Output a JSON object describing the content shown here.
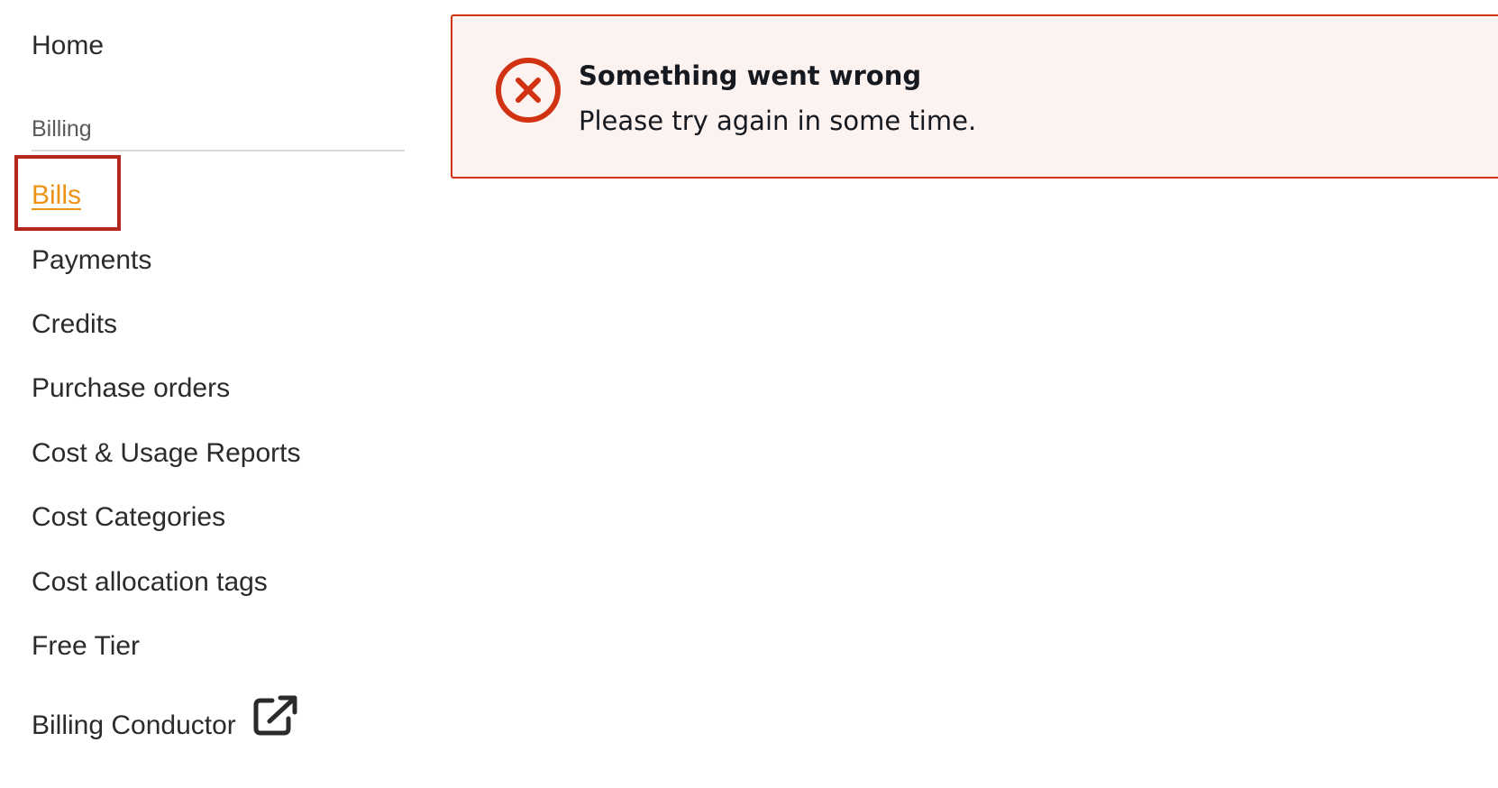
{
  "sidebar": {
    "home_label": "Home",
    "section_title": "Billing",
    "items": [
      {
        "label": "Bills",
        "active": true
      },
      {
        "label": "Payments"
      },
      {
        "label": "Credits"
      },
      {
        "label": "Purchase orders"
      },
      {
        "label": "Cost & Usage Reports"
      },
      {
        "label": "Cost Categories"
      },
      {
        "label": "Cost allocation tags"
      },
      {
        "label": "Free Tier"
      },
      {
        "label": "Billing Conductor",
        "icon": "external-link-icon"
      }
    ]
  },
  "alert": {
    "type": "error",
    "icon": "error-x-circle-icon",
    "title": "Something went wrong",
    "message": "Please try again in some time."
  },
  "colors": {
    "active_link": "#ec9215",
    "error": "#d13212",
    "error_background": "#fcf2f0",
    "highlight": "#b3261e",
    "text": "#2b2b2b"
  }
}
